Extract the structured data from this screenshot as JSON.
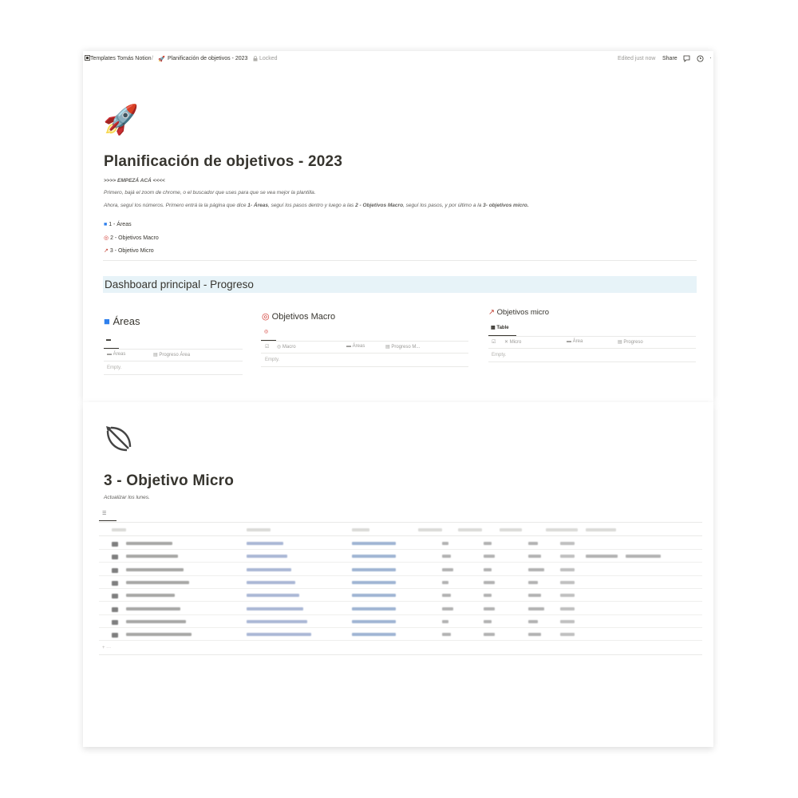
{
  "topbar": {
    "breadcrumb_root": "Templates Tomás Notion",
    "breadcrumb_sep": "/",
    "breadcrumb_page": "Planificación de objetivos - 2023",
    "locked_label": "Locked",
    "edited": "Edited just now",
    "share": "Share"
  },
  "page": {
    "title": "Planificación de objetivos - 2023",
    "start_line": ">>>> EMPEZÁ ACÁ <<<<",
    "line1": "Primero, bajá el zoom de chrome, o el buscador que uses para que se vea mejor la plantilla.",
    "line2_a": "Ahora, seguí los números. Primero entrá la la página que dice ",
    "line2_b": "1- Áreas",
    "line2_c": ", seguí los pasos dentro y luego a las ",
    "line2_d": "2 - Objetivos Macro",
    "line2_e": ", seguí los pasos, y por último a la ",
    "line2_f": "3- objetivos micro.",
    "links": [
      "1 - Áreas",
      "2 - Objetivos Macro",
      "3 - Objetivo Micro"
    ]
  },
  "dashboard": {
    "banner": "Dashboard principal - Progreso",
    "areas": {
      "title": "Áreas",
      "cols": [
        "Áreas",
        "Progreso Área"
      ],
      "empty": "Empty."
    },
    "macro": {
      "title": "Objetivos Macro",
      "cols": [
        "Macro",
        "Áreas",
        "Progreso M..."
      ],
      "empty": "Empty."
    },
    "micro": {
      "title": "Objetivos micro",
      "view": "Table",
      "cols": [
        "Micro",
        "Área",
        "Progreso"
      ],
      "empty": "Empty."
    }
  },
  "micro_page": {
    "title": "3 - Objetivo Micro",
    "subtitle": "Actualizar los lunes.",
    "row_count": 8
  },
  "icons": {
    "rocket": "rocket-icon",
    "bow": "bow-and-arrow-icon",
    "folder": "folder-icon",
    "target": "target-icon",
    "comment": "comment-icon",
    "clock": "clock-icon"
  },
  "colors": {
    "banner": "#e7f3f8",
    "text": "#37352f",
    "muted": "#9b9a97",
    "folder": "#2f80ed",
    "target": "#d0342c"
  }
}
